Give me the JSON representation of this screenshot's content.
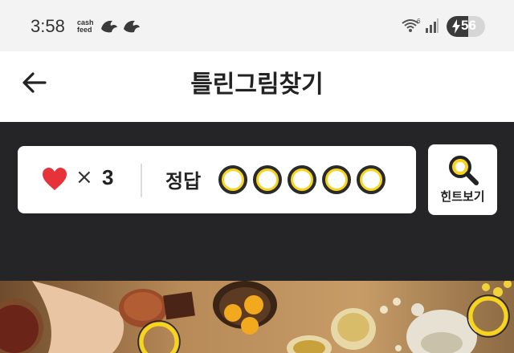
{
  "status_bar": {
    "time": "3:58",
    "cashfeed_line1": "cash",
    "cashfeed_line2": "feed",
    "wifi_badge": "6",
    "battery": "56",
    "battery_level": 0.56
  },
  "header": {
    "title": "틀린그림찾기",
    "back_icon": "arrow-left-icon"
  },
  "game": {
    "lives_symbol": "×",
    "lives_count": "3",
    "answer_label": "정답",
    "answer_slots_total": 5,
    "answer_slots_found": 0,
    "hint_label": "힌트보기",
    "colors": {
      "accent_yellow": "#f7d51d",
      "heart_red": "#e8323a",
      "panel_bg": "#252527"
    }
  }
}
